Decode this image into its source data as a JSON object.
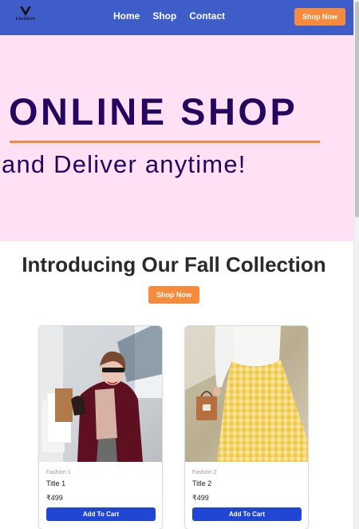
{
  "navbar": {
    "logo_text": "FASHION",
    "links": [
      "Home",
      "Shop",
      "Contact"
    ],
    "cta_label": "Shop Now"
  },
  "hero": {
    "title": "ONLINE SHOP",
    "subtitle": "and Deliver anytime!"
  },
  "collection": {
    "title": "Introducing Our Fall Collection",
    "cta_label": "Shop Now",
    "products": [
      {
        "category": "Fashion 1",
        "title": "Title 1",
        "price": "₹499",
        "button_label": "Add To Cart"
      },
      {
        "category": "Fashion 2",
        "title": "Title 2",
        "price": "₹499",
        "button_label": "Add To Cart"
      }
    ]
  },
  "colors": {
    "navbar": "#3f5dc8",
    "accent": "#f58b3c",
    "hero_bg": "#ffe0f4",
    "hero_text": "#26075f",
    "cart_button": "#1f47d4"
  }
}
